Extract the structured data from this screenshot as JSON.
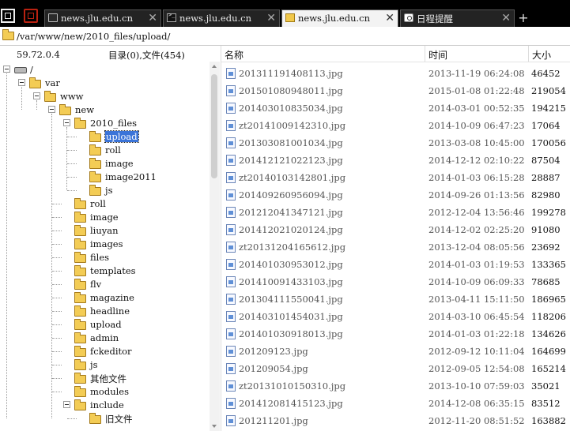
{
  "tabs": [
    {
      "label": "news.jlu.edu.cn",
      "icon": "page-icon",
      "active": false,
      "close": "✕"
    },
    {
      "label": "news.jlu.edu.cn",
      "icon": "terminal-icon",
      "active": false,
      "close": "✕"
    },
    {
      "label": "news.jlu.edu.cn",
      "icon": "folder-icon",
      "active": true,
      "close": "✕"
    },
    {
      "label": "日程提醒",
      "icon": "calendar-icon",
      "active": false,
      "close": "✕"
    }
  ],
  "new_tab": "+",
  "path": "/var/www/new/2010_files/upload/",
  "left": {
    "ip": "59.72.0.4",
    "counts": "目录(0),文件(454)",
    "tree": [
      {
        "label": "/",
        "depth": 0
      },
      {
        "label": "var",
        "depth": 1
      },
      {
        "label": "www",
        "depth": 2
      },
      {
        "label": "new",
        "depth": 3
      },
      {
        "label": "2010_files",
        "depth": 4
      },
      {
        "label": "upload",
        "depth": 5,
        "selected": true
      },
      {
        "label": "roll",
        "depth": 5
      },
      {
        "label": "image",
        "depth": 5
      },
      {
        "label": "image2011",
        "depth": 5
      },
      {
        "label": "js",
        "depth": 5
      },
      {
        "label": "roll",
        "depth": 4
      },
      {
        "label": "image",
        "depth": 4
      },
      {
        "label": "liuyan",
        "depth": 4
      },
      {
        "label": "images",
        "depth": 4
      },
      {
        "label": "files",
        "depth": 4
      },
      {
        "label": "templates",
        "depth": 4
      },
      {
        "label": "flv",
        "depth": 4
      },
      {
        "label": "magazine",
        "depth": 4
      },
      {
        "label": "headline",
        "depth": 4
      },
      {
        "label": "upload",
        "depth": 4
      },
      {
        "label": "admin",
        "depth": 4
      },
      {
        "label": "fckeditor",
        "depth": 4
      },
      {
        "label": "js",
        "depth": 4
      },
      {
        "label": "其他文件",
        "depth": 4
      },
      {
        "label": "modules",
        "depth": 4
      },
      {
        "label": "include",
        "depth": 4
      },
      {
        "label": "旧文件",
        "depth": 5
      }
    ]
  },
  "columns": {
    "name": "名称",
    "time": "时间",
    "size": "大小"
  },
  "files": [
    {
      "name": "201311191408113.jpg",
      "time": "2013-11-19 06:24:08",
      "size": "46452"
    },
    {
      "name": "201501080948011.jpg",
      "time": "2015-01-08 01:22:48",
      "size": "219054"
    },
    {
      "name": "201403010835034.jpg",
      "time": "2014-03-01 00:52:35",
      "size": "194215"
    },
    {
      "name": "zt20141009142310.jpg",
      "time": "2014-10-09 06:47:23",
      "size": "17064"
    },
    {
      "name": "201303081001034.jpg",
      "time": "2013-03-08 10:45:00",
      "size": "170056"
    },
    {
      "name": "201412121022123.jpg",
      "time": "2014-12-12 02:10:22",
      "size": "87504"
    },
    {
      "name": "zt20140103142801.jpg",
      "time": "2014-01-03 06:15:28",
      "size": "28887"
    },
    {
      "name": "201409260956094.jpg",
      "time": "2014-09-26 01:13:56",
      "size": "82980"
    },
    {
      "name": "201212041347121.jpg",
      "time": "2012-12-04 13:56:46",
      "size": "199278"
    },
    {
      "name": "201412021020124.jpg",
      "time": "2014-12-02 02:25:20",
      "size": "91080"
    },
    {
      "name": "zt20131204165612.jpg",
      "time": "2013-12-04 08:05:56",
      "size": "23692"
    },
    {
      "name": "201401030953012.jpg",
      "time": "2014-01-03 01:19:53",
      "size": "133365"
    },
    {
      "name": "201410091433103.jpg",
      "time": "2014-10-09 06:09:33",
      "size": "78685"
    },
    {
      "name": "201304111550041.jpg",
      "time": "2013-04-11 15:11:50",
      "size": "186965"
    },
    {
      "name": "201403101454031.jpg",
      "time": "2014-03-10 06:45:54",
      "size": "118206"
    },
    {
      "name": "201401030918013.jpg",
      "time": "2014-01-03 01:22:18",
      "size": "134626"
    },
    {
      "name": "201209123.jpg",
      "time": "2012-09-12 10:11:04",
      "size": "164699"
    },
    {
      "name": "201209054.jpg",
      "time": "2012-09-05 12:54:08",
      "size": "165214"
    },
    {
      "name": "zt20131010150310.jpg",
      "time": "2013-10-10 07:59:03",
      "size": "35021"
    },
    {
      "name": "201412081415123.jpg",
      "time": "2014-12-08 06:35:15",
      "size": "83512"
    },
    {
      "name": "201211201.jpg",
      "time": "2012-11-20 08:51:52",
      "size": "163882"
    }
  ]
}
